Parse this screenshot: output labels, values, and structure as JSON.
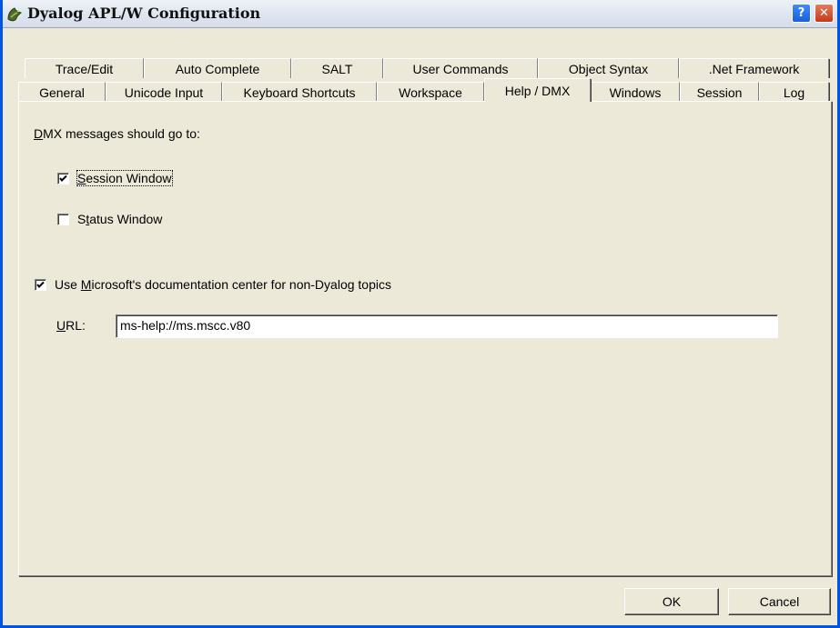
{
  "window": {
    "title": "Dyalog APL/W Configuration",
    "icon": "dyalog-app-icon",
    "help_glyph": "?",
    "close_glyph": "✕"
  },
  "tabs": {
    "row1": [
      "Trace/Edit",
      "Auto Complete",
      "SALT",
      "User Commands",
      "Object Syntax",
      ".Net Framework"
    ],
    "row2": [
      "General",
      "Unicode Input",
      "Keyboard Shortcuts",
      "Workspace",
      "Help / DMX",
      "Windows",
      "Session",
      "Log"
    ],
    "active": "Help / DMX"
  },
  "dmx": {
    "heading_accel": "D",
    "heading_rest": "MX messages should go to:",
    "session_window": {
      "accel": "S",
      "rest": "ession Window",
      "checked": true
    },
    "status_window": {
      "pre": "S",
      "accel": "t",
      "rest": "atus Window",
      "checked": false
    }
  },
  "msdoc": {
    "pre": "Use ",
    "accel": "M",
    "rest": "icrosoft's documentation center for non-Dyalog topics",
    "checked": true
  },
  "url": {
    "accel": "U",
    "rest": "RL:",
    "value": "ms-help://ms.mscc.v80"
  },
  "buttons": {
    "ok": "OK",
    "cancel": "Cancel"
  }
}
